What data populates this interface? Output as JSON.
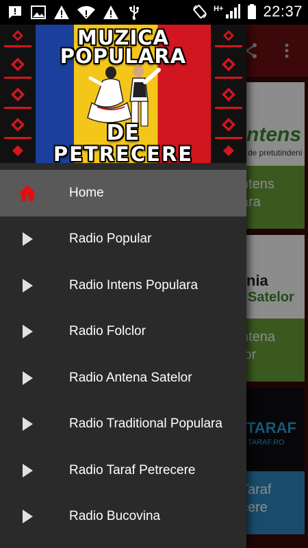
{
  "status_bar": {
    "time": "22:37",
    "network_label": "H+",
    "left_icons": [
      "message-alert-icon",
      "image-icon",
      "warning-icon",
      "wifi-warning-icon",
      "warning-icon",
      "usb-icon"
    ],
    "right_icons": [
      "rotate-icon",
      "signal-icon",
      "battery-icon"
    ]
  },
  "banner": {
    "line1": "MUZICA",
    "line2": "POPULARA",
    "line3": "DE",
    "line4": "PETRECERE"
  },
  "menu": {
    "items": [
      {
        "label": "Home",
        "icon": "home-icon",
        "active": true
      },
      {
        "label": "Radio Popular",
        "icon": "play-arrow-icon",
        "active": false
      },
      {
        "label": "Radio Intens Populara",
        "icon": "play-arrow-icon",
        "active": false
      },
      {
        "label": "Radio Folclor",
        "icon": "play-arrow-icon",
        "active": false
      },
      {
        "label": "Radio Antena Satelor",
        "icon": "play-arrow-icon",
        "active": false
      },
      {
        "label": "Radio Traditional Populara",
        "icon": "play-arrow-icon",
        "active": false
      },
      {
        "label": "Radio Taraf Petrecere",
        "icon": "play-arrow-icon",
        "active": false
      },
      {
        "label": "Radio Bucovina",
        "icon": "play-arrow-icon",
        "active": false
      }
    ]
  },
  "background_cards": [
    {
      "logo_text": "ntens",
      "logo_sub": "de pretutindeni",
      "title_line1": "ntens",
      "title_line2": "ara",
      "color": "#6aa23a"
    },
    {
      "logo_text": "nia",
      "logo_sub": "Satelor",
      "title_line1": "ntena",
      "title_line2": "lor",
      "color": "#6aa23a"
    },
    {
      "logo_text": "TARAF",
      "logo_sub": "TARAF.RO",
      "title_line1": "Taraf",
      "title_line2": "cere",
      "color": "#2f8ac4"
    }
  ],
  "colors": {
    "accent_red": "#e01010",
    "drawer_bg": "#2a2a2a",
    "active_item_bg": "#595959",
    "toolbar": "#6e0f12"
  }
}
